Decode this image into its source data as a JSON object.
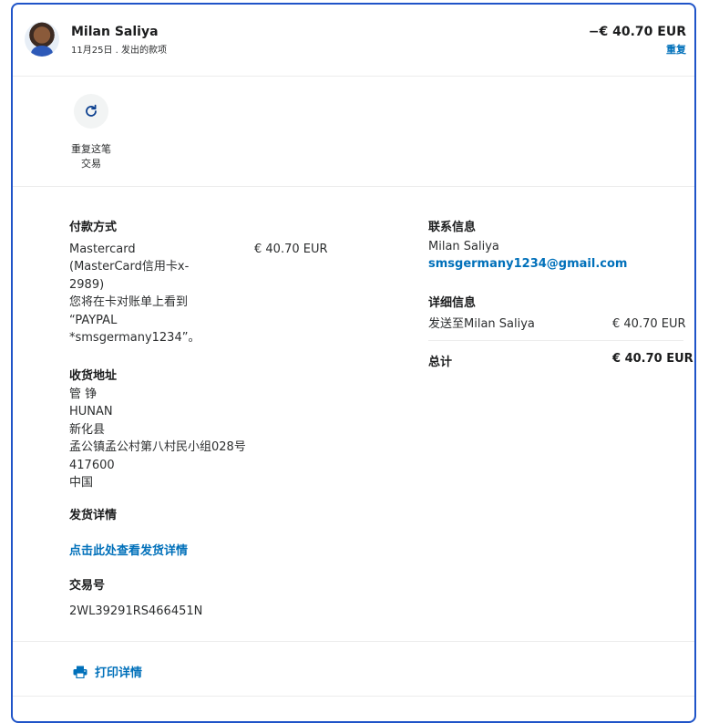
{
  "header": {
    "name": "Milan Saliya",
    "subline": "11月25日 . 发出的款项",
    "amount": "−€ 40.70 EUR",
    "repeat_link": "重复"
  },
  "actions": {
    "repeat_label_line1": "重复这笔",
    "repeat_label_line2": "交易"
  },
  "payment": {
    "title": "付款方式",
    "lines": [
      "Mastercard",
      "(MasterCard信用卡x-",
      "2989)",
      "您将在卡对账单上看到",
      "“PAYPAL",
      "*smsgermany1234”。"
    ],
    "amount": "€ 40.70 EUR"
  },
  "shipping": {
    "title": "收货地址",
    "lines": [
      "管 铮",
      "HUNAN",
      "新化县",
      "孟公镇孟公村第八村民小组028号",
      "417600",
      "中国"
    ]
  },
  "delivery": {
    "title": "发货详情",
    "link": "点击此处查看发货详情"
  },
  "transaction": {
    "title": "交易号",
    "id": "2WL39291RS466451N"
  },
  "contact": {
    "title": "联系信息",
    "name": "Milan Saliya",
    "email": "smsgermany1234@gmail.com"
  },
  "details": {
    "title": "详细信息",
    "sent_to": "发送至Milan Saliya",
    "sent_amount": "€ 40.70 EUR",
    "total_label": "总计",
    "total_amount": "€ 40.70 EUR"
  },
  "footer": {
    "print_label": "打印详情"
  },
  "colors": {
    "link": "#0070ba",
    "border_focus": "#1f54c8"
  },
  "icons": [
    "repeat-icon",
    "printer-icon",
    "avatar"
  ]
}
